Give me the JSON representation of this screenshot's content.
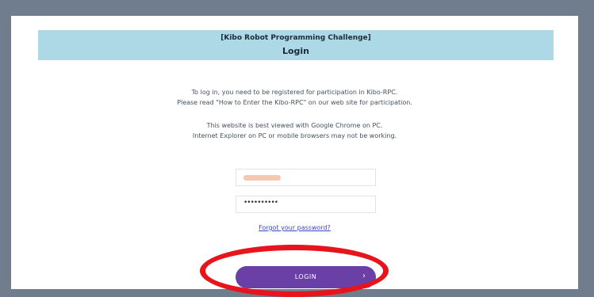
{
  "header": {
    "title": "[Kibo Robot Programming Challenge]",
    "subtitle": "Login"
  },
  "intro": {
    "line1": "To log in, you need to be registered for participation in Kibo-RPC.",
    "line2": "Please read \"How to Enter the Kibo-RPC\" on our web site for participation."
  },
  "browser_note": {
    "line1": "This website is best viewed with Google Chrome on PC.",
    "line2": "Internet Explorer on PC or mobile browsers may not be working."
  },
  "form": {
    "password_value": "••••••••••",
    "forgot_link": "Forgot your password?",
    "login_label": "LOGIN",
    "login_chevron": "›"
  },
  "colors": {
    "banner": "#add8e6",
    "button": "#6a3fa6",
    "highlight": "#e8141b",
    "link": "#3b48c9"
  }
}
